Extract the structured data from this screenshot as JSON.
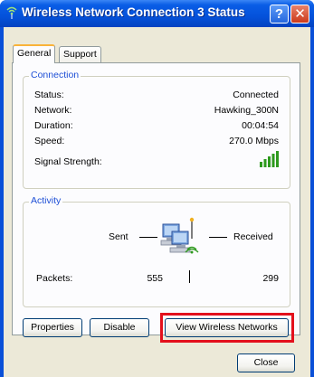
{
  "window": {
    "title": "Wireless Network Connection 3 Status",
    "help_label": "?",
    "close_label": "✕"
  },
  "tabs": [
    {
      "label": "General",
      "active": true
    },
    {
      "label": "Support",
      "active": false
    }
  ],
  "connection": {
    "legend": "Connection",
    "status_label": "Status:",
    "status_value": "Connected",
    "network_label": "Network:",
    "network_value": "Hawking_300N",
    "duration_label": "Duration:",
    "duration_value": "00:04:54",
    "speed_label": "Speed:",
    "speed_value": "270.0 Mbps",
    "signal_label": "Signal Strength:",
    "signal_icon": "signal-bars-icon"
  },
  "activity": {
    "legend": "Activity",
    "sent_label": "Sent",
    "received_label": "Received",
    "packets_label": "Packets:",
    "packets_sent": "555",
    "packets_received": "299",
    "icon": "wireless-network-computers-icon"
  },
  "buttons": {
    "properties": "Properties",
    "disable": "Disable",
    "view_wireless": "View Wireless Networks",
    "close": "Close"
  },
  "colors": {
    "titlebar": "#0452db",
    "highlight": "#e3101c",
    "legend_text": "#1e4fd6",
    "dialog_bg": "#ece9d8"
  }
}
